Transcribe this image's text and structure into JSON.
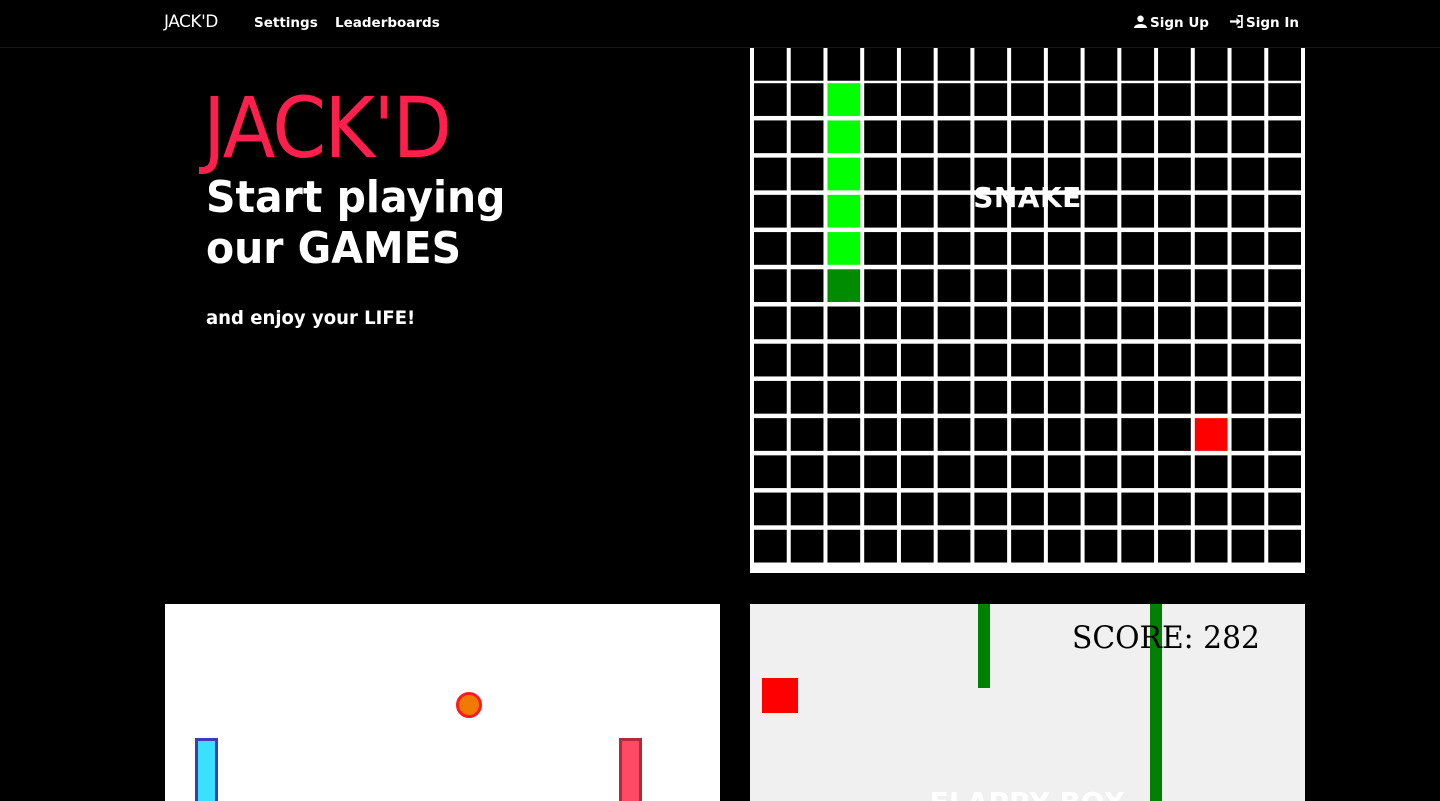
{
  "nav": {
    "brand": "JACK'D",
    "links": [
      "Settings",
      "Leaderboards"
    ],
    "sign_up": "Sign Up",
    "sign_in": "Sign In"
  },
  "hero": {
    "brand": "JACK'D",
    "title_line1": "Start playing",
    "title_line2": "our GAMES",
    "subtitle": "and enjoy your LIFE!"
  },
  "games": {
    "snake": {
      "label": "SNAKE",
      "grid": {
        "cols": 15,
        "rows": 14
      },
      "snake_cells": [
        [
          2,
          1
        ],
        [
          2,
          2
        ],
        [
          2,
          3
        ],
        [
          2,
          4
        ],
        [
          2,
          5
        ],
        [
          2,
          6
        ]
      ],
      "snake_head": [
        2,
        6
      ],
      "food": [
        12,
        10
      ],
      "colors": {
        "body": "#00ff00",
        "head": "#008c00",
        "food": "#ff0000",
        "grid": "#ffffff",
        "cell": "#000000"
      }
    },
    "pong": {
      "colors": {
        "ball": "#f07b00",
        "ball_border": "#ff1a1a",
        "left_paddle": "#3ce0ff",
        "right_paddle": "#ff4a63"
      }
    },
    "flappy": {
      "score_label": "SCORE: 282",
      "label": "FLAPPY BOX",
      "colors": {
        "pipe": "#008000",
        "box": "#ff0000",
        "bg": "#f0f0f0"
      }
    }
  }
}
